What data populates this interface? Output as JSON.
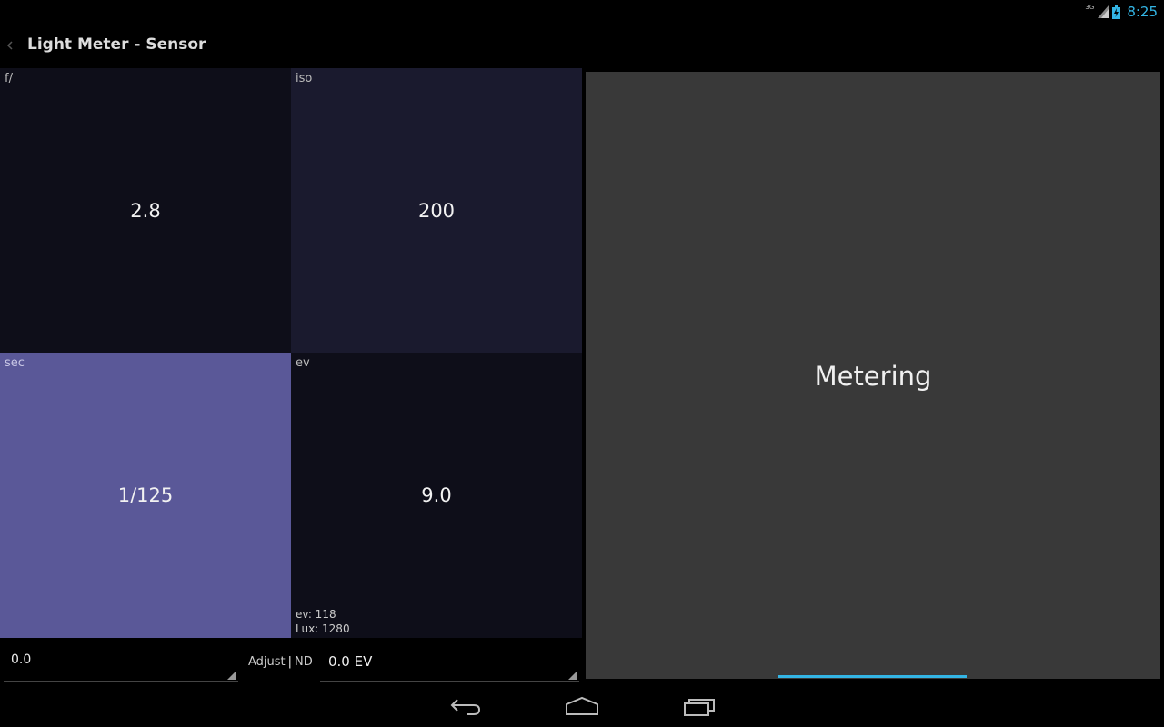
{
  "status_bar": {
    "network_type": "3G",
    "time": "8:25",
    "icons": [
      "signal-icon",
      "battery-charging-icon"
    ]
  },
  "action_bar": {
    "title": "Light Meter - Sensor",
    "up_icon": "chevron-left-icon"
  },
  "tiles": {
    "aperture": {
      "label": "f/",
      "value": "2.8"
    },
    "iso": {
      "label": "iso",
      "value": "200"
    },
    "shutter": {
      "label": "sec",
      "value": "1/125"
    },
    "ev": {
      "label": "ev",
      "value": "9.0",
      "info_ev": "ev: 118",
      "info_lux": "Lux: 1280"
    }
  },
  "controls": {
    "adjust_value": "0.0",
    "adjust_label": "Adjust",
    "separator": "|",
    "nd_label": "ND",
    "ev_value": "0.0 EV"
  },
  "metering": {
    "text": "Metering"
  },
  "nav_bar": {
    "icons": [
      "back-icon",
      "home-icon",
      "recents-icon"
    ]
  },
  "colors": {
    "accent": "#33b5e5",
    "tile_dark": "#0e0e19",
    "tile_iso": "#1a1a2e",
    "tile_selected": "#5a5898",
    "panel": "#393939"
  }
}
